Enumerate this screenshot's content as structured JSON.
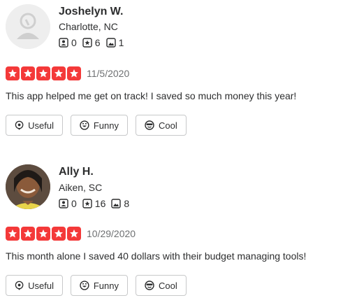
{
  "reviews": [
    {
      "name": "Joshelyn W.",
      "location": "Charlotte, NC",
      "friends": "0",
      "reviews": "6",
      "photos": "1",
      "rating": 5,
      "date": "11/5/2020",
      "text": "This app helped me get on track! I saved so much money this year!",
      "buttons": {
        "useful": "Useful",
        "funny": "Funny",
        "cool": "Cool"
      },
      "avatar": "default-avatar-icon"
    },
    {
      "name": "Ally H.",
      "location": "Aiken, SC",
      "friends": "0",
      "reviews": "16",
      "photos": "8",
      "rating": 5,
      "date": "10/29/2020",
      "text": "This month alone I saved 40 dollars with their budget managing tools!",
      "buttons": {
        "useful": "Useful",
        "funny": "Funny",
        "cool": "Cool"
      },
      "avatar": "user-photo"
    }
  ],
  "colors": {
    "star": "#f43939",
    "text": "#2d2e2f",
    "muted": "#6e7072",
    "border": "#c8c9ca"
  }
}
